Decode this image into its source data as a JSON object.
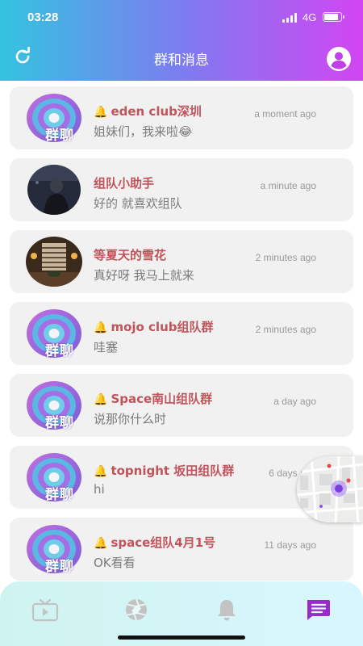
{
  "status_bar": {
    "time": "03:28",
    "network": "4G"
  },
  "header": {
    "title": "群和消息"
  },
  "conversations": [
    {
      "name": "eden club深圳",
      "time": "a moment ago",
      "message": "姐妹们，我来啦😂",
      "muted": true,
      "avatar": "group-badge-icon",
      "avatar_label": "群聊"
    },
    {
      "name": "组队小助手",
      "time": "a minute ago",
      "message": "好的 就喜欢组队",
      "muted": false,
      "avatar": "user-photo-dark"
    },
    {
      "name": "等夏天的雪花",
      "time": "2 minutes ago",
      "message": "真好呀 我马上就来",
      "muted": false,
      "avatar": "user-photo-room"
    },
    {
      "name": "mojo club组队群",
      "time": "2 minutes ago",
      "message": "哇塞",
      "muted": true,
      "avatar": "group-badge-icon",
      "avatar_label": "群聊"
    },
    {
      "name": "Space南山组队群",
      "time": "a day ago",
      "message": "说那你什么时",
      "muted": true,
      "avatar": "group-badge-icon",
      "avatar_label": "群聊"
    },
    {
      "name": "topnight 坂田组队群",
      "time": "6 days ago",
      "message": "hi",
      "muted": true,
      "avatar": "group-badge-icon",
      "avatar_label": "群聊"
    },
    {
      "name": "space组队4月1号",
      "time": "11 days ago",
      "message": "OK看看",
      "muted": true,
      "avatar": "group-badge-icon",
      "avatar_label": "群聊"
    }
  ],
  "tabs": [
    {
      "icon": "tv-icon",
      "active": false
    },
    {
      "icon": "aperture-icon",
      "active": false
    },
    {
      "icon": "bell-icon",
      "active": false
    },
    {
      "icon": "chat-icon",
      "active": true
    }
  ],
  "colors": {
    "header_start": "#33c4e0",
    "header_end": "#d245f2",
    "name": "#c0545a",
    "active_tab": "#9b2bc9",
    "inactive_tab": "#c3c3c3"
  }
}
